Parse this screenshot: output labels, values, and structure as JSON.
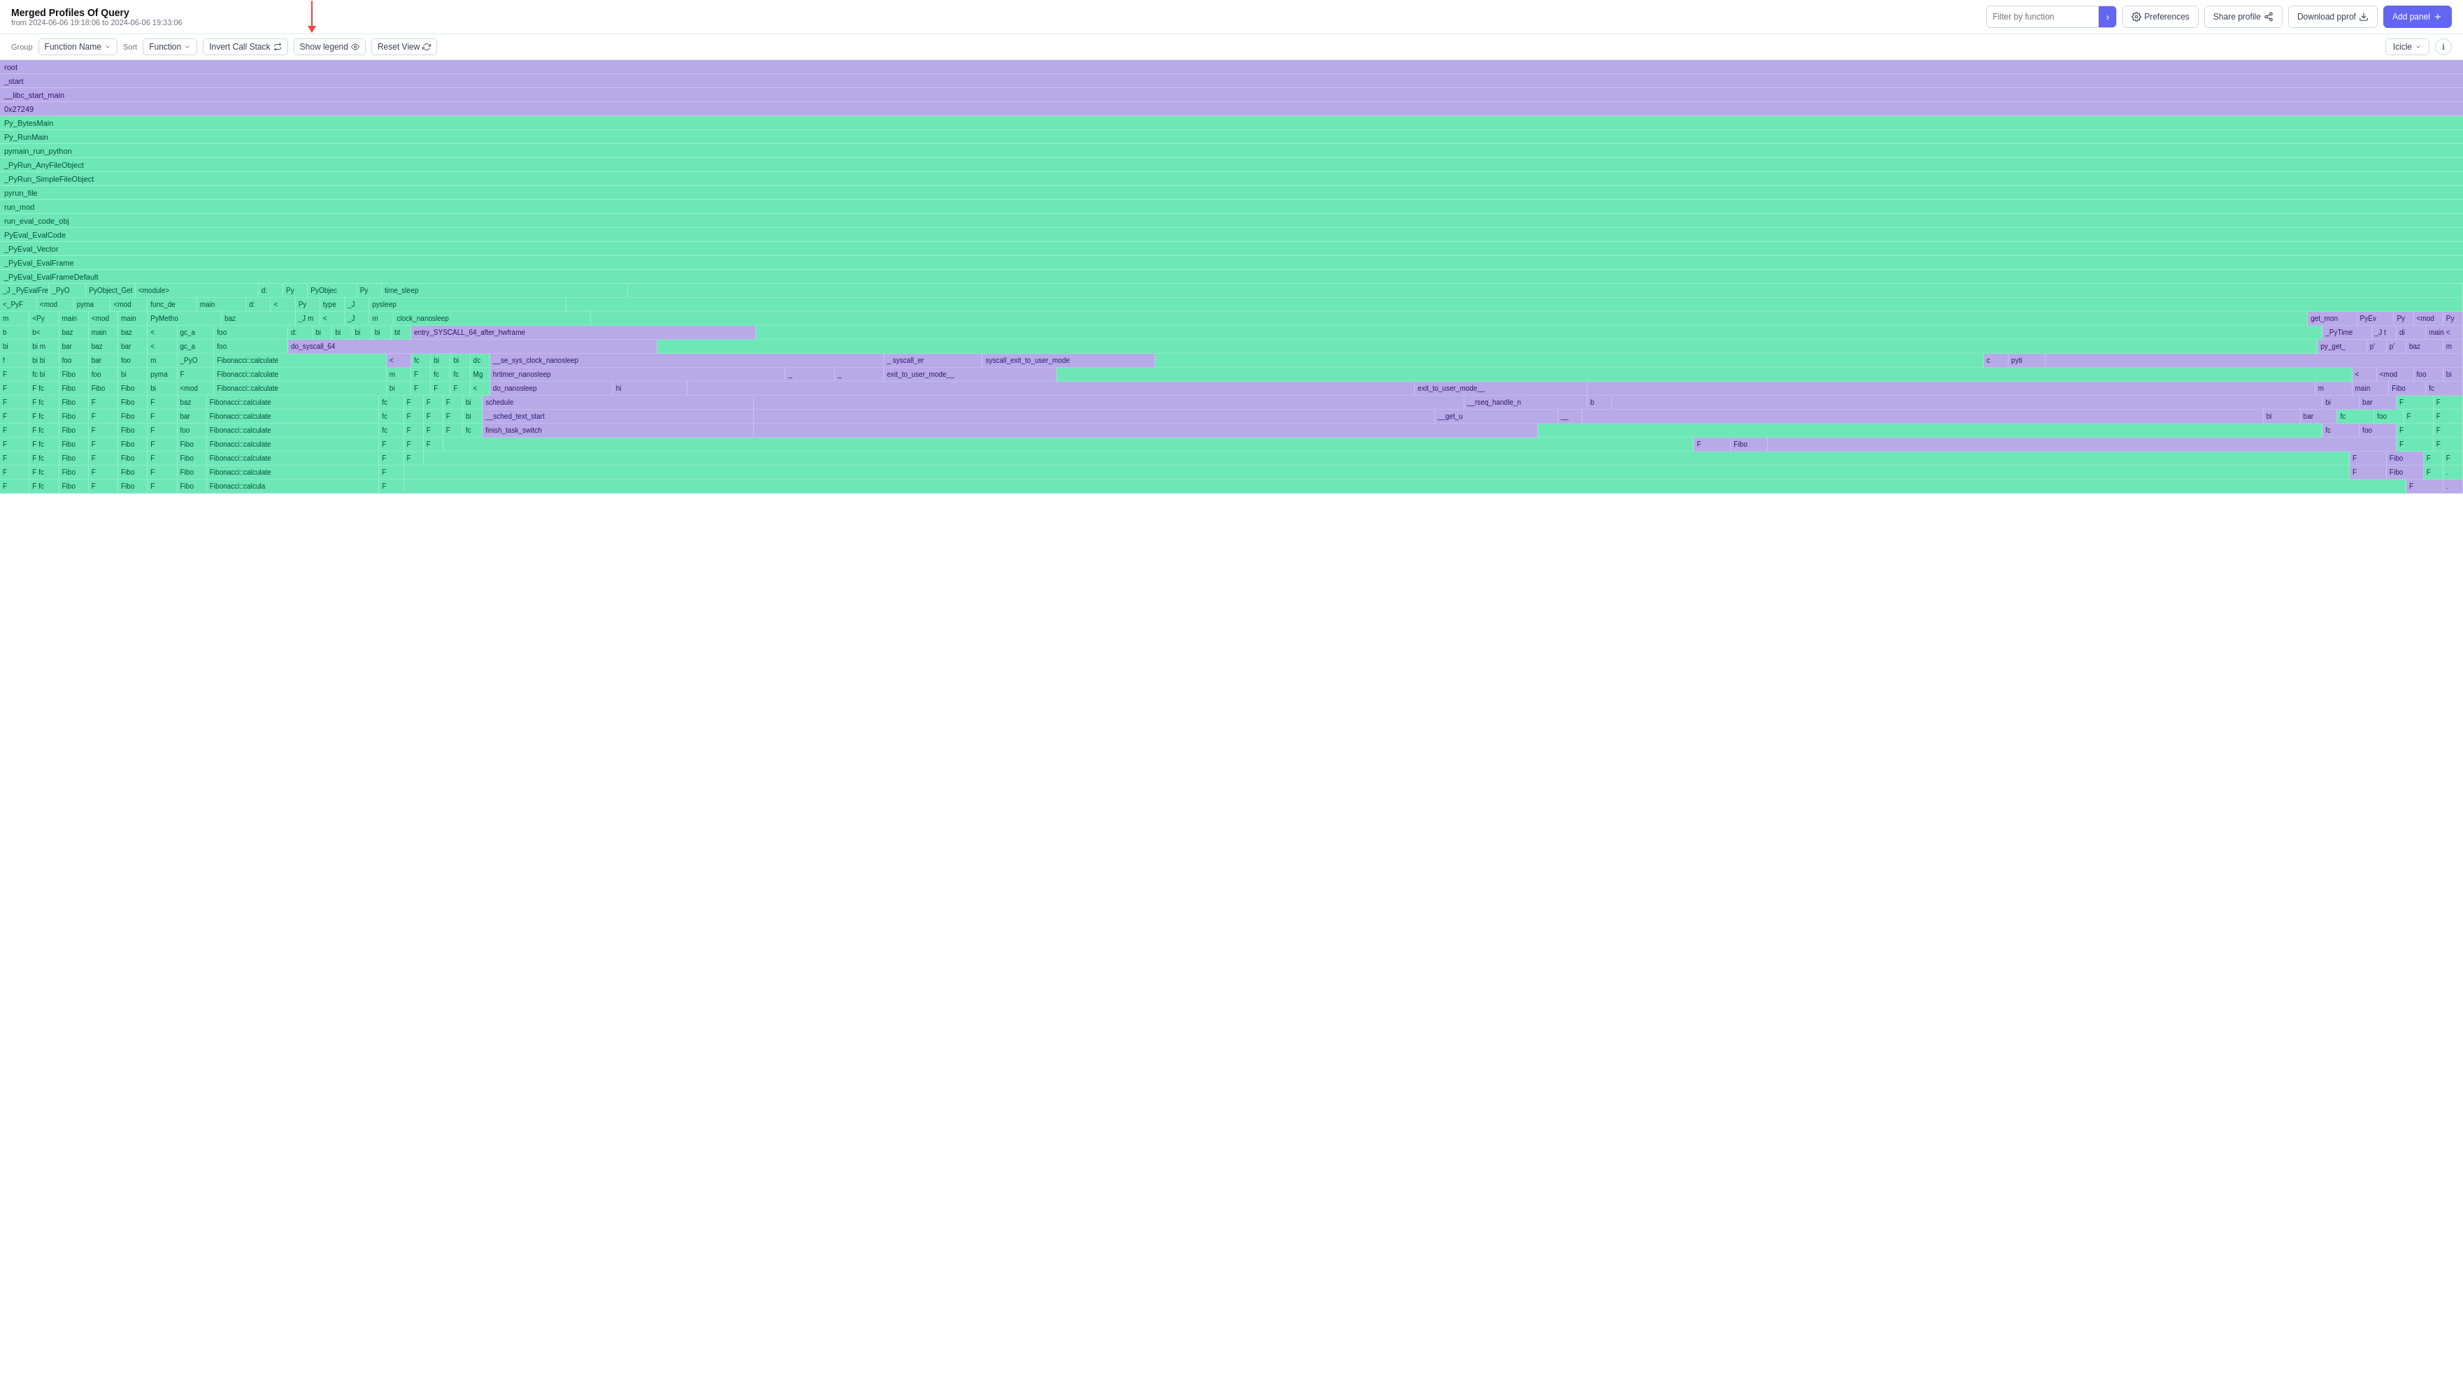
{
  "header": {
    "title": "Merged Profiles Of Query",
    "subtitle": "from 2024-06-06 19:18:06 to 2024-06-06 19:33:06",
    "filter_placeholder": "Filter by function",
    "filter_arrow_label": "→",
    "preferences_label": "Preferences",
    "share_label": "Share profile",
    "download_label": "Download pprof",
    "add_panel_label": "Add panel"
  },
  "toolbar": {
    "group_label": "Group",
    "sort_label": "Sort",
    "function_name_label": "Function Name",
    "function_label": "Function",
    "invert_call_stack_label": "Invert Call Stack",
    "show_legend_label": "Show legend",
    "reset_view_label": "Reset View",
    "icicle_label": "Icicle"
  },
  "flame": {
    "rows": [
      {
        "label": "root",
        "color": "purple-light",
        "full": true
      },
      {
        "label": "_start",
        "color": "purple-light",
        "full": true
      },
      {
        "label": "__libc_start_main",
        "color": "purple-light",
        "full": true
      },
      {
        "label": "0x27249",
        "color": "purple-light",
        "full": true
      },
      {
        "label": "Py_BytesMain",
        "color": "green",
        "full": true
      },
      {
        "label": "Py_RunMain",
        "color": "green",
        "full": true
      },
      {
        "label": "pymain_run_python",
        "color": "green",
        "full": true
      },
      {
        "label": "_PyRun_AnyFileObject",
        "color": "green",
        "full": true
      },
      {
        "label": "_PyRun_SimpleFileObject",
        "color": "green",
        "full": true
      },
      {
        "label": "pyrun_file",
        "color": "green",
        "full": true
      },
      {
        "label": "run_mod",
        "color": "green",
        "full": true
      },
      {
        "label": "run_eval_code_obj",
        "color": "green",
        "full": true
      },
      {
        "label": "PyEval_EvalCode",
        "color": "green",
        "full": true
      },
      {
        "label": "_PyEval_Vector",
        "color": "green",
        "full": true
      },
      {
        "label": "_PyEval_EvalFrame",
        "color": "green",
        "full": true
      },
      {
        "label": "_PyEval_EvalFrameDefault",
        "color": "green",
        "full": true
      }
    ]
  }
}
